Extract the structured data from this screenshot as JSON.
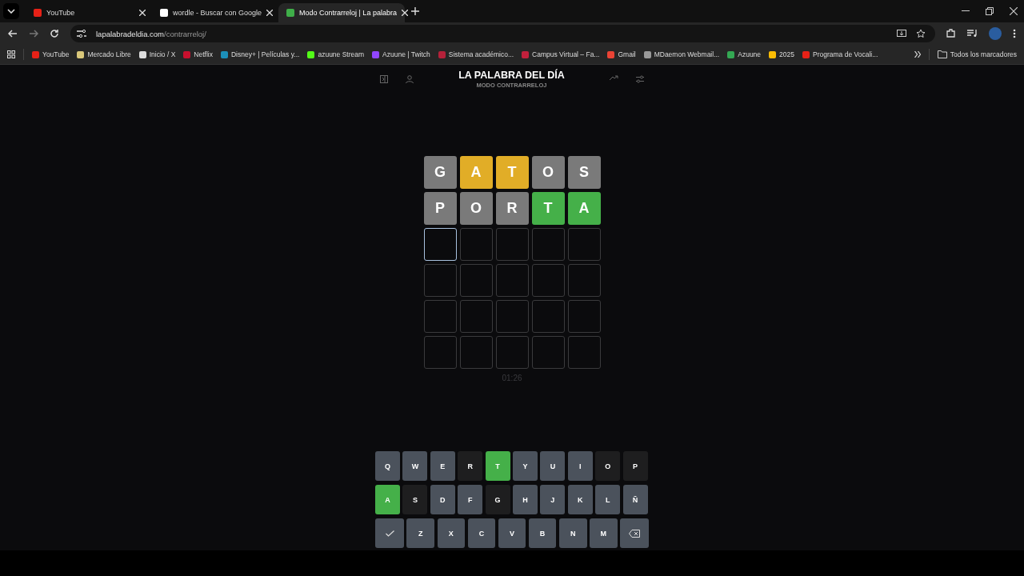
{
  "tabs": [
    {
      "title": "YouTube",
      "selected": false
    },
    {
      "title": "wordle - Buscar con Google",
      "selected": false
    },
    {
      "title": "Modo Contrarreloj | La palabra",
      "selected": true
    }
  ],
  "address": {
    "domain": "lapalabradeldia.com",
    "path": "/contrarreloj/"
  },
  "bookmarks": [
    {
      "label": "YouTube"
    },
    {
      "label": "Mercado Libre"
    },
    {
      "label": "Inicio / X"
    },
    {
      "label": "Netflix"
    },
    {
      "label": "Disney+ | Películas y..."
    },
    {
      "label": "azuune Stream"
    },
    {
      "label": "Azuune | Twitch"
    },
    {
      "label": "Sistema académico..."
    },
    {
      "label": "Campus Virtual – Fa..."
    },
    {
      "label": "Gmail"
    },
    {
      "label": "MDaemon Webmail..."
    },
    {
      "label": "Azuune"
    },
    {
      "label": "2025"
    },
    {
      "label": "Programa de Vocali..."
    }
  ],
  "all_bookmarks": "Todos los marcadores",
  "game": {
    "title": "LA PALABRA DEL DÍA",
    "subtitle": "MODO CONTRARRELOJ",
    "board": [
      [
        {
          "letter": "G",
          "color": "#7a7a7a",
          "active": false
        },
        {
          "letter": "A",
          "color": "#e1ad27",
          "active": false
        },
        {
          "letter": "T",
          "color": "#e1ad27",
          "active": false
        },
        {
          "letter": "O",
          "color": "#7a7a7a",
          "active": false
        },
        {
          "letter": "S",
          "color": "#7a7a7a",
          "active": false
        }
      ],
      [
        {
          "letter": "P",
          "color": "#7a7a7a",
          "active": false
        },
        {
          "letter": "O",
          "color": "#7a7a7a",
          "active": false
        },
        {
          "letter": "R",
          "color": "#7a7a7a",
          "active": false
        },
        {
          "letter": "T",
          "color": "#45b049",
          "active": false
        },
        {
          "letter": "A",
          "color": "#45b049",
          "active": false
        }
      ],
      [
        {
          "active": true
        },
        {
          "active": false
        },
        {
          "active": false
        },
        {
          "active": false
        },
        {
          "active": false
        }
      ],
      [
        {
          "active": false
        },
        {
          "active": false
        },
        {
          "active": false
        },
        {
          "active": false
        },
        {
          "active": false
        }
      ],
      [
        {
          "active": false
        },
        {
          "active": false
        },
        {
          "active": false
        },
        {
          "active": false
        },
        {
          "active": false
        }
      ],
      [
        {
          "active": false
        },
        {
          "active": false
        },
        {
          "active": false
        },
        {
          "active": false
        },
        {
          "active": false
        }
      ]
    ],
    "timer": "01:26",
    "keyboard": [
      [
        {
          "key": "Q",
          "color": "#4b525c"
        },
        {
          "key": "W",
          "color": "#4b525c"
        },
        {
          "key": "E",
          "color": "#4b525c"
        },
        {
          "key": "R",
          "color": "#1e1e1f"
        },
        {
          "key": "T",
          "color": "#45b049"
        },
        {
          "key": "Y",
          "color": "#4b525c"
        },
        {
          "key": "U",
          "color": "#4b525c"
        },
        {
          "key": "I",
          "color": "#4b525c"
        },
        {
          "key": "O",
          "color": "#1e1e1f"
        },
        {
          "key": "P",
          "color": "#1e1e1f"
        }
      ],
      [
        {
          "key": "A",
          "color": "#45b049"
        },
        {
          "key": "S",
          "color": "#1e1e1f"
        },
        {
          "key": "D",
          "color": "#4b525c"
        },
        {
          "key": "F",
          "color": "#4b525c"
        },
        {
          "key": "G",
          "color": "#1e1e1f"
        },
        {
          "key": "H",
          "color": "#4b525c"
        },
        {
          "key": "J",
          "color": "#4b525c"
        },
        {
          "key": "K",
          "color": "#4b525c"
        },
        {
          "key": "L",
          "color": "#4b525c"
        },
        {
          "key": "Ñ",
          "color": "#4b525c"
        }
      ],
      [
        {
          "kind": "enter",
          "color": "#4b525c"
        },
        {
          "key": "Z",
          "color": "#4b525c"
        },
        {
          "key": "X",
          "color": "#4b525c"
        },
        {
          "key": "C",
          "color": "#4b525c"
        },
        {
          "key": "V",
          "color": "#4b525c"
        },
        {
          "key": "B",
          "color": "#4b525c"
        },
        {
          "key": "N",
          "color": "#4b525c"
        },
        {
          "key": "M",
          "color": "#4b525c"
        },
        {
          "kind": "backspace",
          "color": "#4b525c"
        }
      ]
    ]
  }
}
